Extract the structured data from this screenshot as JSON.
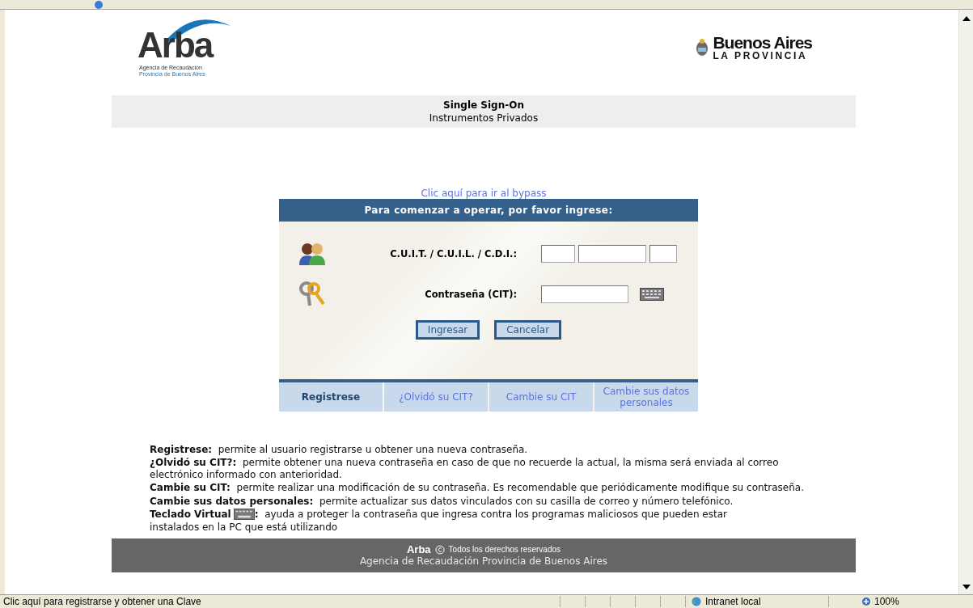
{
  "header": {
    "arba_logo": {
      "name": "Arba",
      "line1": "Agencia de Recaudación",
      "line2": "Provincia de Buenos Aires"
    },
    "province_logo": {
      "name": "Buenos Aires",
      "subtitle": "LA PROVINCIA"
    }
  },
  "banner": {
    "title": "Single Sign-On",
    "subtitle": "Instrumentos Privados"
  },
  "bypass_link": "Clic aquí para ir al bypass",
  "login": {
    "heading": "Para comenzar a operar, por favor ingrese:",
    "cuit_label": "C.U.I.T. / C.U.I.L. / C.D.I.:",
    "password_label": "Contraseña (CIT):",
    "buttons": [
      "Ingresar",
      "Cancelar"
    ]
  },
  "links": [
    {
      "label": "Registrese",
      "selected": true
    },
    {
      "label": "¿Olvidó su CIT?",
      "selected": false
    },
    {
      "label": "Cambie su CIT",
      "selected": false
    },
    {
      "label": "Cambie sus datos personales",
      "selected": false
    }
  ],
  "help": [
    {
      "kind": "plain",
      "term": "Registrese:",
      "text": "permite al usuario registrarse u obtener una nueva contraseña."
    },
    {
      "kind": "plain",
      "term": "¿Olvidó su CIT?:",
      "text": "permite obtener una nueva contraseña en caso de que no recuerde la actual, la misma será enviada al correo electrónico informado con anterioridad."
    },
    {
      "kind": "plain",
      "term": "Cambie su CIT:",
      "text": "permite realizar una modificación de su contraseña. Es recomendable que periódicamente modifique su contraseña."
    },
    {
      "kind": "plain",
      "term": "Cambie sus datos personales:",
      "text": "permite actualizar sus datos vinculados con su casilla de correo y número telefónico."
    },
    {
      "kind": "keyboard",
      "term": "Teclado Virtual",
      "after": ":",
      "text": "ayuda a proteger la contraseña que ingresa contra los programas maliciosos que pueden estar",
      "text_line2": "instalados en la PC que está utilizando"
    }
  ],
  "footer": {
    "brand": "Arba",
    "rights": "Todos los derechos reservados",
    "agency": "Agencia de Recaudación Provincia de Buenos Aires"
  },
  "status_bar": {
    "message": "Clic aquí para registrarse y obtener una Clave",
    "zone": "Intranet local",
    "zoom": "100%"
  }
}
